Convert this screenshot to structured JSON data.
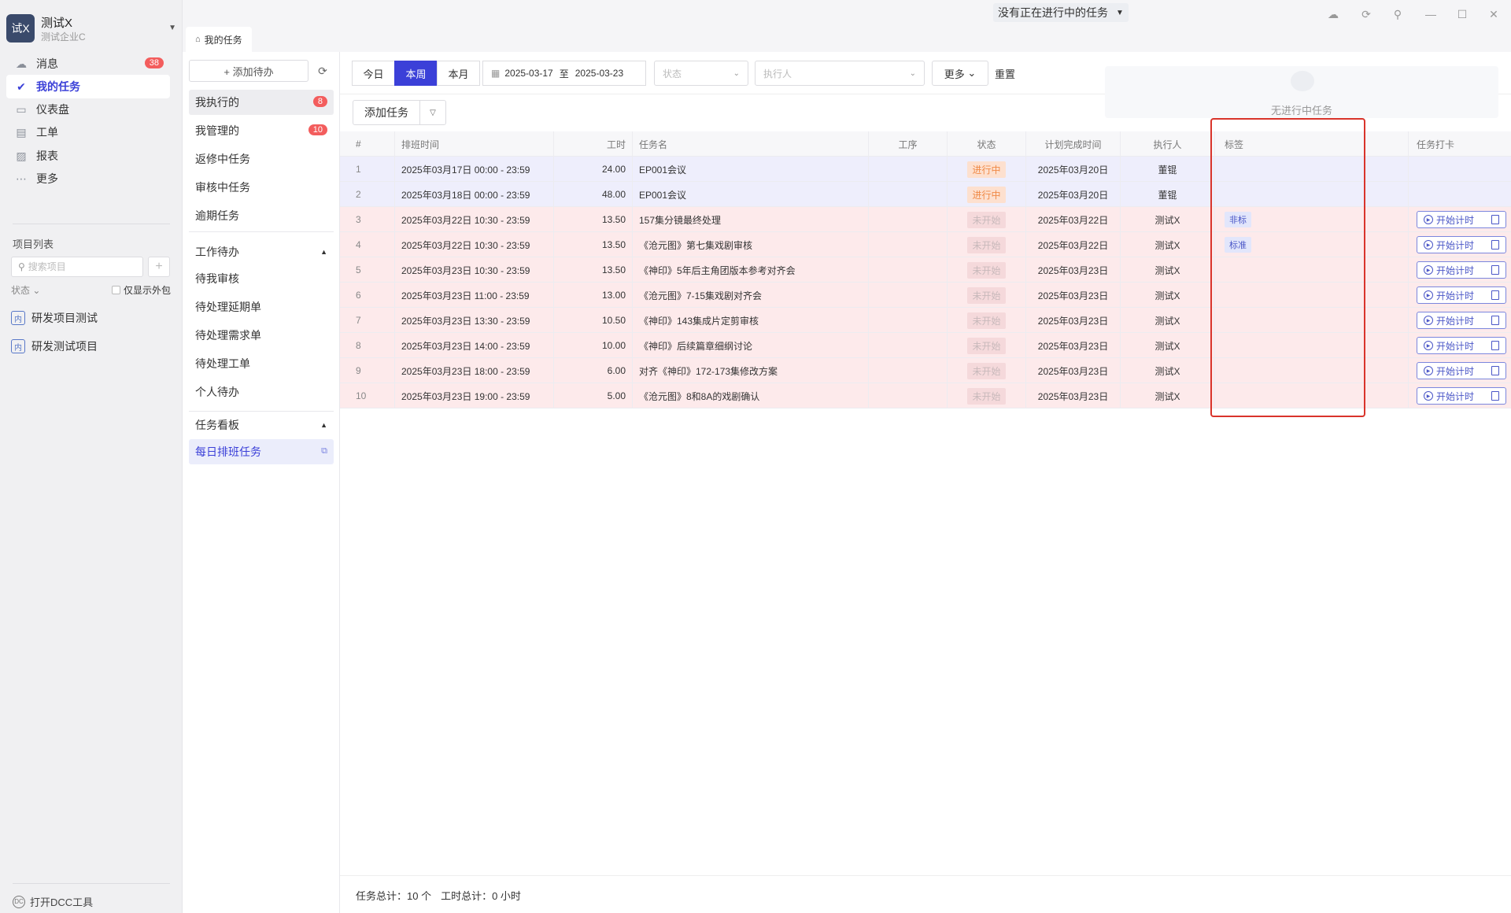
{
  "org": {
    "logo_text": "试X",
    "name": "测试X",
    "company": "测试企业C"
  },
  "nav": [
    {
      "label": "消息",
      "icon": "chat-icon",
      "badge": "38"
    },
    {
      "label": "我的任务",
      "icon": "task-check-icon",
      "active": true
    },
    {
      "label": "仪表盘",
      "icon": "dashboard-icon"
    },
    {
      "label": "工单",
      "icon": "ticket-icon"
    },
    {
      "label": "报表",
      "icon": "report-icon"
    },
    {
      "label": "更多",
      "icon": "more-icon"
    }
  ],
  "projects": {
    "title": "项目列表",
    "search_placeholder": "搜索项目",
    "status_filter": "状态",
    "only_outsourced": "仅显示外包",
    "items": [
      {
        "badge": "内",
        "name": "研发项目测试"
      },
      {
        "badge": "内",
        "name": "研发测试项目"
      }
    ]
  },
  "bottom": {
    "open_dcc": "打开DCC工具"
  },
  "topbar": {
    "running_task": "没有正在进行中的任务",
    "tab_label": "我的任务"
  },
  "mid": {
    "add_todo": "+ 添加待办",
    "lists": [
      {
        "label": "我执行的",
        "badge": "8",
        "selected": true
      },
      {
        "label": "我管理的",
        "badge": "10"
      },
      {
        "label": "返修中任务"
      },
      {
        "label": "审核中任务"
      },
      {
        "label": "逾期任务"
      }
    ],
    "todo_section": "工作待办",
    "todo_items": [
      "待我审核",
      "待处理延期单",
      "待处理需求单",
      "待处理工单",
      "个人待办"
    ],
    "board_section": "任务看板",
    "board_items": [
      "每日排班任务"
    ]
  },
  "filters": {
    "segments": [
      "今日",
      "本周",
      "本月"
    ],
    "active_segment": "本周",
    "date_from": "2025-03-17",
    "date_sep": "至",
    "date_to": "2025-03-23",
    "status_placeholder": "状态",
    "executor_placeholder": "执行人",
    "more": "更多",
    "reset": "重置"
  },
  "add_task": "添加任务",
  "no_running": "无进行中任务",
  "table": {
    "headers": [
      "#",
      "排班时间",
      "工时",
      "任务名",
      "工序",
      "状态",
      "计划完成时间",
      "执行人",
      "标签",
      "任务打卡"
    ],
    "rows": [
      {
        "idx": "1",
        "time": "2025年03月17日 00:00 - 23:59",
        "hours": "24.00",
        "name": "EP001会议",
        "status": "进行中",
        "due": "2025年03月20日",
        "exec": "董锟",
        "tag": "",
        "style": "purple",
        "checkin": ""
      },
      {
        "idx": "2",
        "time": "2025年03月18日 00:00 - 23:59",
        "hours": "48.00",
        "name": "EP001会议",
        "status": "进行中",
        "due": "2025年03月20日",
        "exec": "董锟",
        "tag": "",
        "style": "purple",
        "checkin": ""
      },
      {
        "idx": "3",
        "time": "2025年03月22日 10:30 - 23:59",
        "hours": "13.50",
        "name": "157集分镜最终处理",
        "status": "未开始",
        "due": "2025年03月22日",
        "exec": "测试X",
        "tag": "非标",
        "style": "pink",
        "checkin": "开始计时"
      },
      {
        "idx": "4",
        "time": "2025年03月22日 10:30 - 23:59",
        "hours": "13.50",
        "name": "《沧元图》第七集戏剧审核",
        "status": "未开始",
        "due": "2025年03月22日",
        "exec": "测试X",
        "tag": "标准",
        "style": "pink",
        "checkin": "开始计时"
      },
      {
        "idx": "5",
        "time": "2025年03月23日 10:30 - 23:59",
        "hours": "13.50",
        "name": "《神印》5年后主角团版本参考对齐会",
        "status": "未开始",
        "due": "2025年03月23日",
        "exec": "测试X",
        "tag": "",
        "style": "pink",
        "checkin": "开始计时"
      },
      {
        "idx": "6",
        "time": "2025年03月23日 11:00 - 23:59",
        "hours": "13.00",
        "name": "《沧元图》7-15集戏剧对齐会",
        "status": "未开始",
        "due": "2025年03月23日",
        "exec": "测试X",
        "tag": "",
        "style": "pink",
        "checkin": "开始计时"
      },
      {
        "idx": "7",
        "time": "2025年03月23日 13:30 - 23:59",
        "hours": "10.50",
        "name": "《神印》143集成片定剪审核",
        "status": "未开始",
        "due": "2025年03月23日",
        "exec": "测试X",
        "tag": "",
        "style": "pink",
        "checkin": "开始计时"
      },
      {
        "idx": "8",
        "time": "2025年03月23日 14:00 - 23:59",
        "hours": "10.00",
        "name": "《神印》后续篇章细纲讨论",
        "status": "未开始",
        "due": "2025年03月23日",
        "exec": "测试X",
        "tag": "",
        "style": "pink",
        "checkin": "开始计时"
      },
      {
        "idx": "9",
        "time": "2025年03月23日 18:00 - 23:59",
        "hours": "6.00",
        "name": "对齐《神印》172-173集修改方案",
        "status": "未开始",
        "due": "2025年03月23日",
        "exec": "测试X",
        "tag": "",
        "style": "pink",
        "checkin": "开始计时"
      },
      {
        "idx": "10",
        "time": "2025年03月23日 19:00 - 23:59",
        "hours": "5.00",
        "name": "《沧元图》8和8A的戏剧确认",
        "status": "未开始",
        "due": "2025年03月23日",
        "exec": "测试X",
        "tag": "",
        "style": "pink",
        "checkin": "开始计时"
      }
    ]
  },
  "footer": {
    "task_total": "任务总计：10 个",
    "hours_total": "工时总计：0 小时"
  },
  "colors": {
    "accent": "#3b40d8",
    "badge_red": "#f35d5d",
    "row_purple": "#eeeefc",
    "row_pink": "#fdeaeb",
    "highlight_red": "#d9342b"
  }
}
